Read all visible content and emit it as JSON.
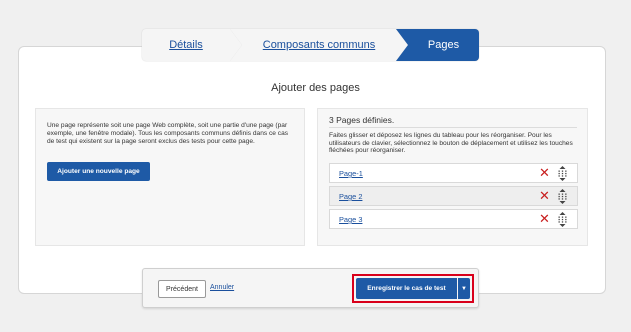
{
  "wizard": {
    "steps": [
      {
        "label": "Détails",
        "state": "link"
      },
      {
        "label": "Composants communs",
        "state": "link"
      },
      {
        "label": "Pages",
        "state": "current"
      }
    ]
  },
  "main": {
    "title": "Ajouter des pages"
  },
  "left_panel": {
    "description": "Une page représente soit une page Web complète, soit une partie d'une page (par exemple, une fenêtre modale). Tous les composants communs définis dans ce cas de test qui existent sur la page seront exclus des tests pour cette page.",
    "add_button": "Ajouter une nouvelle page"
  },
  "right_panel": {
    "heading": "3 Pages définies.",
    "instructions": "Faites glisser et déposez les lignes du tableau pour les réorganiser. Pour les utilisateurs de clavier, sélectionnez le bouton de déplacement et utilisez les touches fléchées pour réorganiser.",
    "pages": [
      {
        "label": "Page-1"
      },
      {
        "label": "Page 2"
      },
      {
        "label": "Page 3"
      }
    ],
    "icons": {
      "delete": "close-icon",
      "move": "drag-handle-icon"
    }
  },
  "footer": {
    "previous": "Précédent",
    "cancel": "Annuler",
    "save": "Enregistrer le cas de test",
    "save_dropdown": "▼"
  },
  "colors": {
    "primary": "#1e5aa6",
    "link": "#1a4f9c",
    "delete": "#c81e1e",
    "highlight": "#d9001b",
    "background": "#f0f0f0"
  }
}
